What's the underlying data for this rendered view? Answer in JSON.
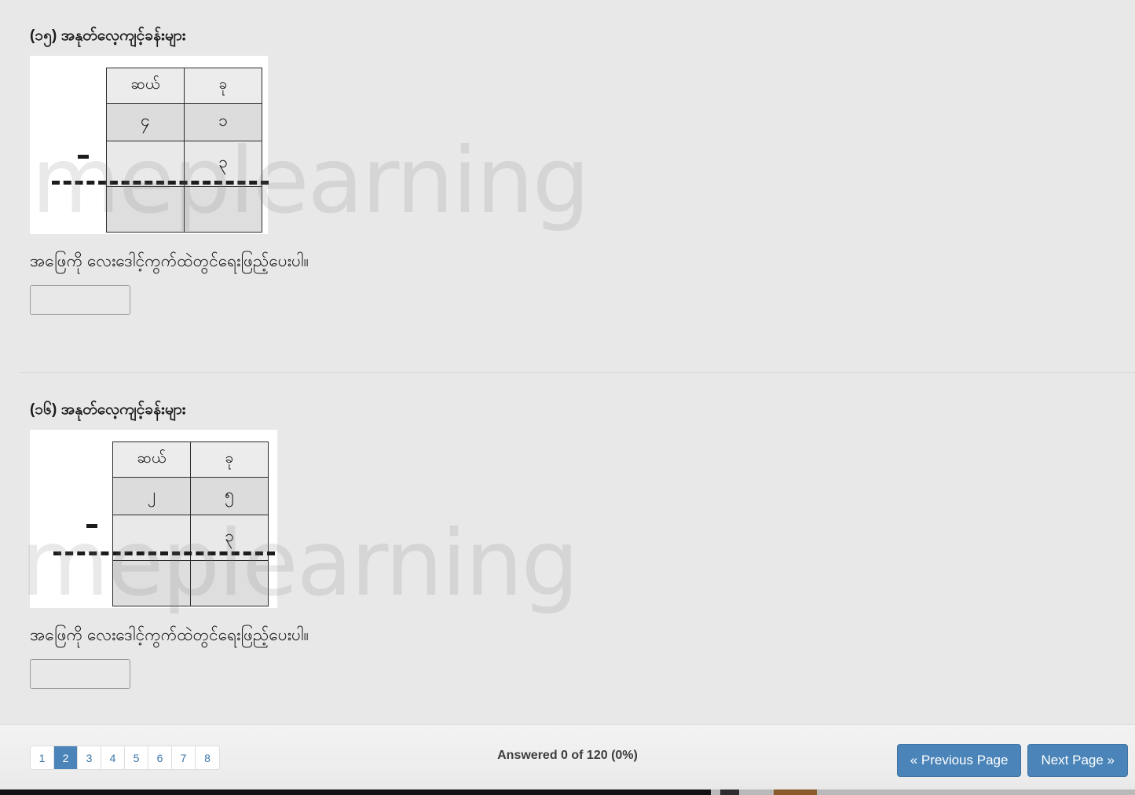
{
  "watermark": {
    "text": "meplearning"
  },
  "questions": [
    {
      "number_label": "(၁၅)",
      "title": "(၁၅) အနုတ်လေ့ကျင့်ခန်းများ",
      "table": {
        "headers": [
          "ဆယ်",
          "ခု"
        ],
        "rows": [
          [
            "၄",
            "၁"
          ],
          [
            "",
            "၃"
          ],
          [
            "",
            ""
          ]
        ]
      },
      "instruction": "အဖြေကို လေးဒေါင့်ကွက်ထဲတွင်ရေးဖြည့်ပေးပါ။",
      "answer_value": "",
      "answer_placeholder": ""
    },
    {
      "number_label": "(၁၆)",
      "title": "(၁၆) အနုတ်လေ့ကျင့်ခန်းများ",
      "table": {
        "headers": [
          "ဆယ်",
          "ခု"
        ],
        "rows": [
          [
            "၂",
            "၅"
          ],
          [
            "",
            "၃"
          ],
          [
            "",
            ""
          ]
        ]
      },
      "instruction": "အဖြေကို လေးဒေါင့်ကွက်ထဲတွင်ရေးဖြည့်ပေးပါ။",
      "answer_value": "",
      "answer_placeholder": ""
    }
  ],
  "footer": {
    "pages": [
      "1",
      "2",
      "3",
      "4",
      "5",
      "6",
      "7",
      "8"
    ],
    "active_page": "2",
    "answered_status": "Answered 0 of 120 (0%)",
    "previous_label": "« Previous Page",
    "next_label": "Next Page »",
    "accent_color": "#4a84b8",
    "link_color": "#3a74a8"
  }
}
